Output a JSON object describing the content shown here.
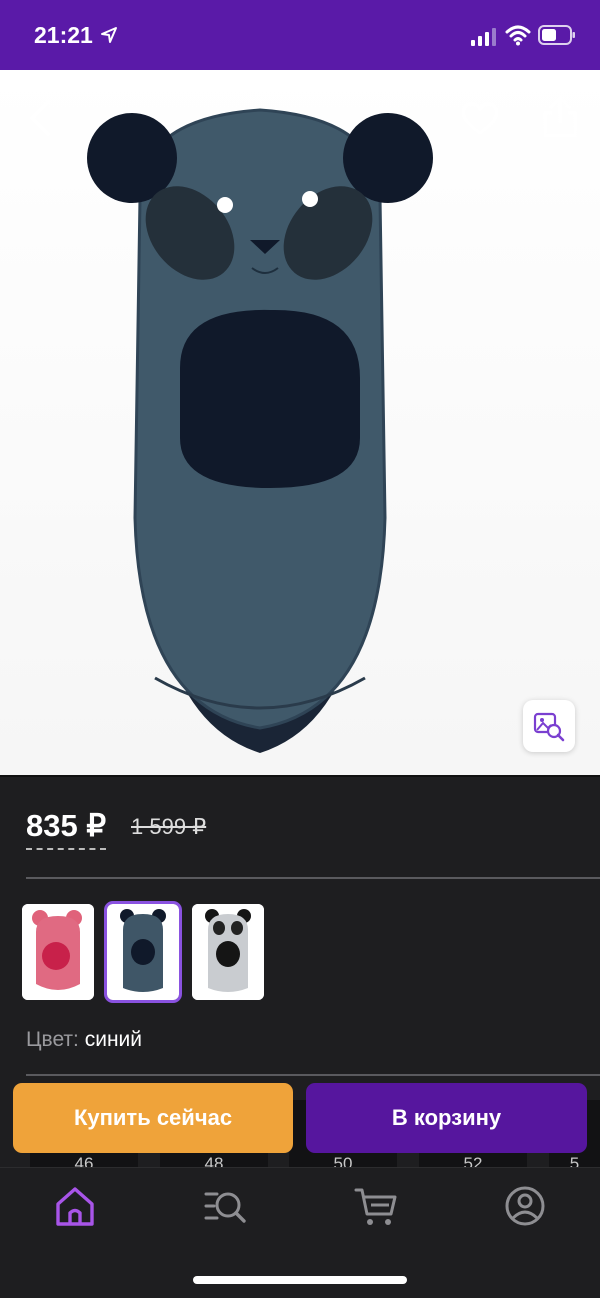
{
  "status_bar": {
    "time": "21:21",
    "icons": [
      "location-arrow-icon",
      "cellular-signal-icon",
      "wifi-icon",
      "battery-icon"
    ]
  },
  "product_header": {
    "icons": [
      "back-chevron-icon",
      "heart-icon",
      "share-icon",
      "visual-search-icon"
    ]
  },
  "price": {
    "current": "835 ₽",
    "old": "1 599 ₽"
  },
  "color": {
    "label": "Цвет:",
    "value": "синий",
    "swatches": [
      "pink",
      "blue",
      "grey"
    ],
    "selected_index": 1
  },
  "sizes": [
    "46",
    "48",
    "50",
    "52",
    "5"
  ],
  "actions": {
    "buy_now": "Купить сейчас",
    "add_to_cart": "В корзину"
  },
  "tab_bar": {
    "items": [
      "home-icon",
      "catalog-search-icon",
      "cart-icon",
      "profile-icon"
    ],
    "active_index": 0
  },
  "colors": {
    "status_bar_bg": "#5a1aa8",
    "accent_purple": "#56169e",
    "buy_orange": "#efa33a",
    "dark_bg": "#1e1e20"
  }
}
